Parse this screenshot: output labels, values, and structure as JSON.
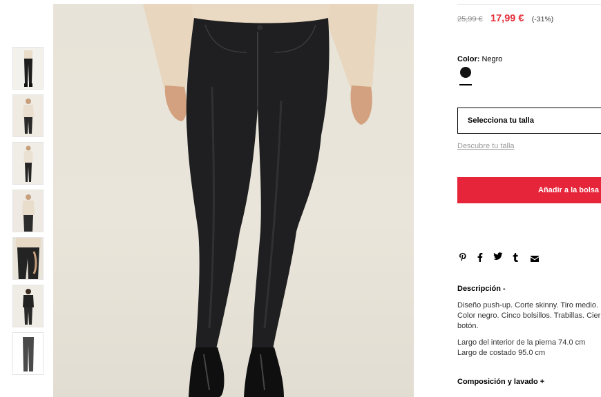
{
  "gallery": {
    "thumbnails": [
      {
        "alt": "Front view jeans"
      },
      {
        "alt": "Model with sweater"
      },
      {
        "alt": "Model full body"
      },
      {
        "alt": "Model side view"
      },
      {
        "alt": "Detail pocket"
      },
      {
        "alt": "Back view"
      },
      {
        "alt": "Flat lay jeans"
      }
    ]
  },
  "product": {
    "old_price": "25,99 €",
    "price": "17,99 €",
    "discount": "(-31%)",
    "color_label": "Color:",
    "color_value": "Negro",
    "swatch_color": "#111111",
    "size_placeholder": "Selecciona tu talla",
    "size_help": "Descubre tu talla",
    "add_to_bag": "Añadir a la bolsa",
    "accent_color": "#e6243a"
  },
  "share": {
    "icons": [
      "pinterest-icon",
      "facebook-icon",
      "twitter-icon",
      "tumblr-icon",
      "email-icon"
    ]
  },
  "details": {
    "description_title": "Descripción -",
    "description_p1": "Diseño push-up. Corte skinny. Tiro medio. Color negro. Cinco bolsillos. Trabillas. Cierre botón.",
    "description_p2_line1": "Largo del interior de la pierna 74.0 cm",
    "description_p2_line2": "Largo de costado 95.0 cm",
    "composition_title": "Composición y lavado +"
  }
}
